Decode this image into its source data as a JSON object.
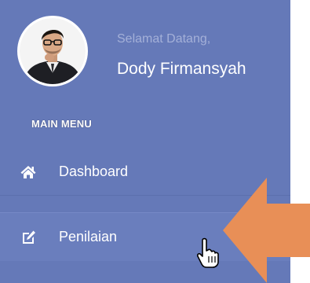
{
  "sidebar": {
    "background_color": "#6579b8",
    "user": {
      "avatar": "user-avatar-photo",
      "welcome_text": "Selamat Datang,",
      "name": "Dody Firmansyah"
    },
    "menu_header": "MAIN MENU",
    "items": [
      {
        "label": "Dashboard",
        "icon": "home-icon"
      },
      {
        "label": "Penilaian",
        "icon": "edit-icon",
        "hovered": true
      }
    ]
  },
  "overlay": {
    "arrow_color": "#e88f57",
    "cursor": "hand-pointer-cursor"
  }
}
